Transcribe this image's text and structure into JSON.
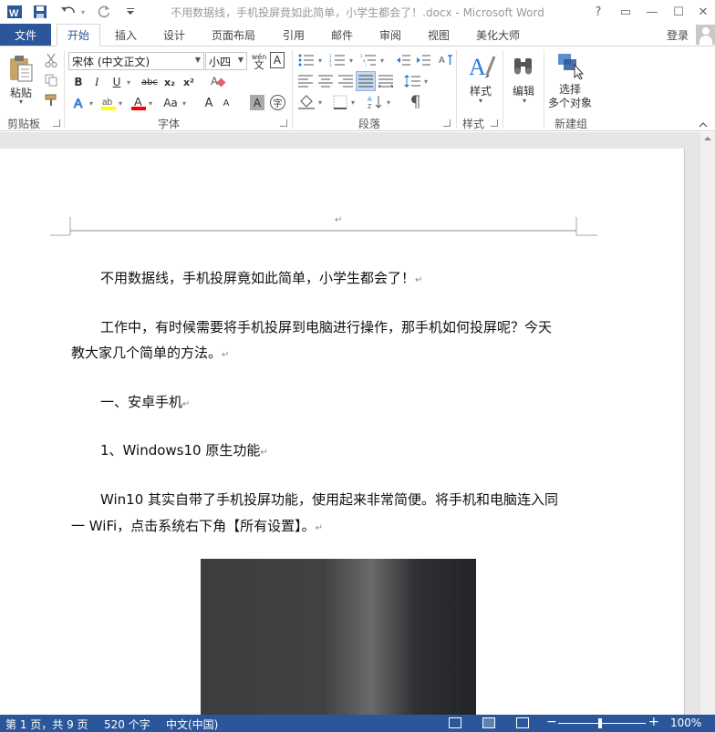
{
  "title": "不用数据线，手机投屏竟如此简单，小学生都会了！.docx - Microsoft Word",
  "window_buttons": [
    "?",
    "▭",
    "—",
    "☐",
    "✕"
  ],
  "tabs": {
    "file": "文件",
    "items": [
      "开始",
      "插入",
      "设计",
      "页面布局",
      "引用",
      "邮件",
      "审阅",
      "视图",
      "美化大师"
    ],
    "active": "开始"
  },
  "login": "登录",
  "ribbon": {
    "clipboard": {
      "paste": "粘贴",
      "label": "剪贴板"
    },
    "font": {
      "name": "宋体 (中文正文)",
      "size": "小四",
      "wen": "wén",
      "wen_char": "文",
      "a_boxed": "A",
      "bold": "B",
      "italic": "I",
      "underline": "U",
      "strike": "abc",
      "sub": "x₂",
      "sup": "x²",
      "font_color": "A",
      "grow": "A",
      "shrink": "A",
      "aa": "Aa",
      "char_shade": "A",
      "circle_char": "字",
      "label": "字体"
    },
    "paragraph": {
      "label": "段落"
    },
    "styles": {
      "button": "样式",
      "label": "样式"
    },
    "editing": {
      "button": "编辑"
    },
    "select": {
      "line1": "选择",
      "line2": "多个对象",
      "label": "新建组"
    }
  },
  "document": {
    "lines": [
      "不用数据线，手机投屏竟如此简单，小学生都会了！",
      "工作中，有时候需要将手机投屏到电脑进行操作，那手机如何投屏呢？今天",
      "教大家几个简单的方法。",
      "一、安卓手机",
      "1、Windows10 原生功能",
      "Win10 其实自带了手机投屏功能，使用起来非常简便。将手机和电脑连入同",
      "一 WiFi，点击系统右下角【所有设置】。"
    ],
    "para_mark": "↵",
    "header_mark": "↵"
  },
  "status": {
    "page": "第 1 页，共 9 页",
    "words": "520 个字",
    "lang": "中文(中国)",
    "zoom_minus": "−",
    "zoom_plus": "+",
    "zoom": "100%"
  },
  "colors": {
    "accent": "#2b579a",
    "highlight": "#ffff00",
    "font_color": "#ff0000"
  }
}
